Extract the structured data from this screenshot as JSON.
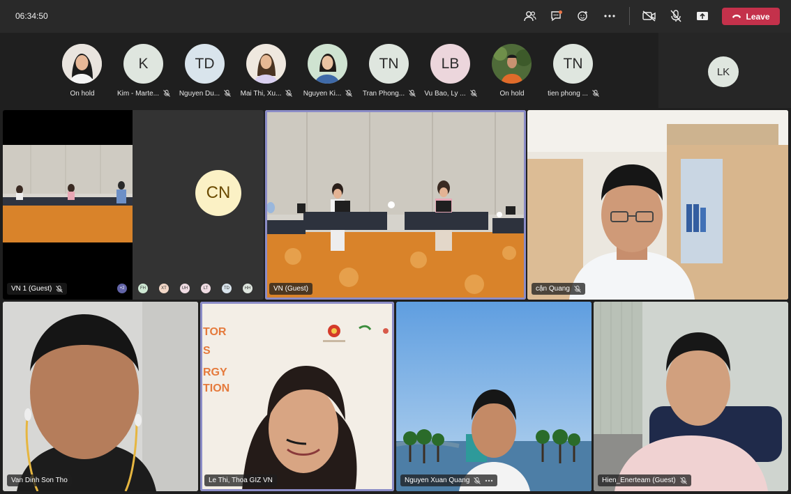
{
  "topbar": {
    "clock": "06:34:50",
    "leave_label": "Leave",
    "icons": [
      "people-icon",
      "chat-icon",
      "reactions-icon",
      "more-icon",
      "camera-off-icon",
      "mic-off-icon",
      "share-icon"
    ]
  },
  "strip": {
    "participants": [
      {
        "initials": "",
        "label": "On hold",
        "photo": true,
        "muted": false
      },
      {
        "initials": "K",
        "label": "Kim - Marte...",
        "photo": false,
        "muted": true
      },
      {
        "initials": "TD",
        "label": "Nguyen Du...",
        "photo": false,
        "muted": true
      },
      {
        "initials": "",
        "label": "Mai Thi, Xu...",
        "photo": true,
        "muted": true
      },
      {
        "initials": "",
        "label": "Nguyen Ki...",
        "photo": true,
        "muted": true
      },
      {
        "initials": "TN",
        "label": "Tran Phong...",
        "photo": false,
        "muted": true
      },
      {
        "initials": "LB",
        "label": "Vu Bao, Ly ...",
        "photo": false,
        "muted": true
      },
      {
        "initials": "",
        "label": "On hold",
        "photo": true,
        "muted": false
      },
      {
        "initials": "TN",
        "label": "tien phong ...",
        "photo": false,
        "muted": true
      }
    ],
    "overflow_initials": "LK"
  },
  "tiles": {
    "vn1": {
      "label": "VN 1 (Guest)",
      "avatar": "CN",
      "chips": [
        "+2",
        "FH",
        "XT",
        "UH",
        "LT",
        "TD",
        "HH"
      ]
    },
    "vn": {
      "label": "VN (Guest)"
    },
    "can_quang": {
      "label": "cận Quang"
    },
    "van_dinh": {
      "label": "Van Dinh Son Tho"
    },
    "le_thi": {
      "label": "Le Thi, Thoa GIZ VN",
      "slide_lines": [
        "TOR",
        "S",
        "RGY",
        "TION"
      ]
    },
    "nguyen_xuan": {
      "label": "Nguyen Xuan Quang"
    },
    "hien": {
      "label": "Hien_Enerteam (Guest)"
    }
  },
  "colors": {
    "leave": "#c4314b",
    "active_border": "#8b8cc7",
    "topbar": "#292929"
  }
}
